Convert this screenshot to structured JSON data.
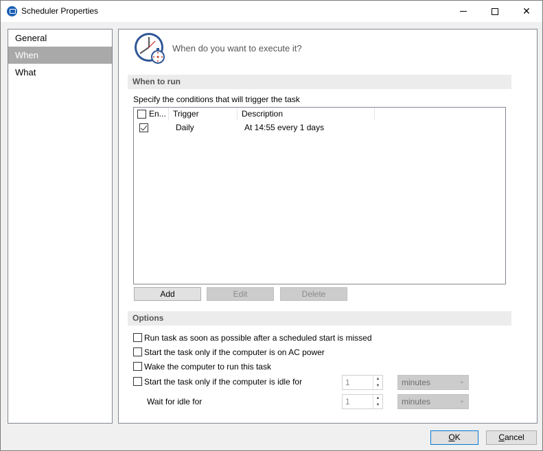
{
  "window": {
    "title": "Scheduler Properties",
    "icon": "scheduler-app-icon"
  },
  "titlebar_controls": {
    "minimize_icon": "minimize-icon",
    "maximize_icon": "maximize-icon",
    "close_glyph": "✕"
  },
  "nav": {
    "items": [
      {
        "label": "General",
        "selected": false
      },
      {
        "label": "When",
        "selected": true
      },
      {
        "label": "What",
        "selected": false
      }
    ]
  },
  "header": {
    "icon": "clock-timer-icon",
    "text": "When do you want to execute it?"
  },
  "when_to_run": {
    "title": "When to run",
    "description": "Specify the conditions that will trigger the task",
    "columns": [
      "En...",
      "Trigger",
      "Description"
    ],
    "rows": [
      {
        "enabled": true,
        "trigger": "Daily",
        "description": "At 14:55 every 1 days"
      }
    ],
    "buttons": {
      "add": "Add",
      "edit": "Edit",
      "delete": "Delete"
    }
  },
  "options": {
    "title": "Options",
    "checkboxes": [
      {
        "label": "Run task as soon as possible after a scheduled start is missed",
        "checked": false
      },
      {
        "label": "Start the task only if the computer is on AC power",
        "checked": false
      },
      {
        "label": "Wake the computer to run this task",
        "checked": false
      },
      {
        "label": "Start the task only if the computer is idle for",
        "checked": false
      }
    ],
    "idle_value": "1",
    "idle_unit": "minutes",
    "wait_label": "Wait for idle for",
    "wait_value": "1",
    "wait_unit": "minutes"
  },
  "footer": {
    "ok_accel": "O",
    "ok_rest": "K",
    "cancel_accel": "C",
    "cancel_rest": "ancel"
  }
}
